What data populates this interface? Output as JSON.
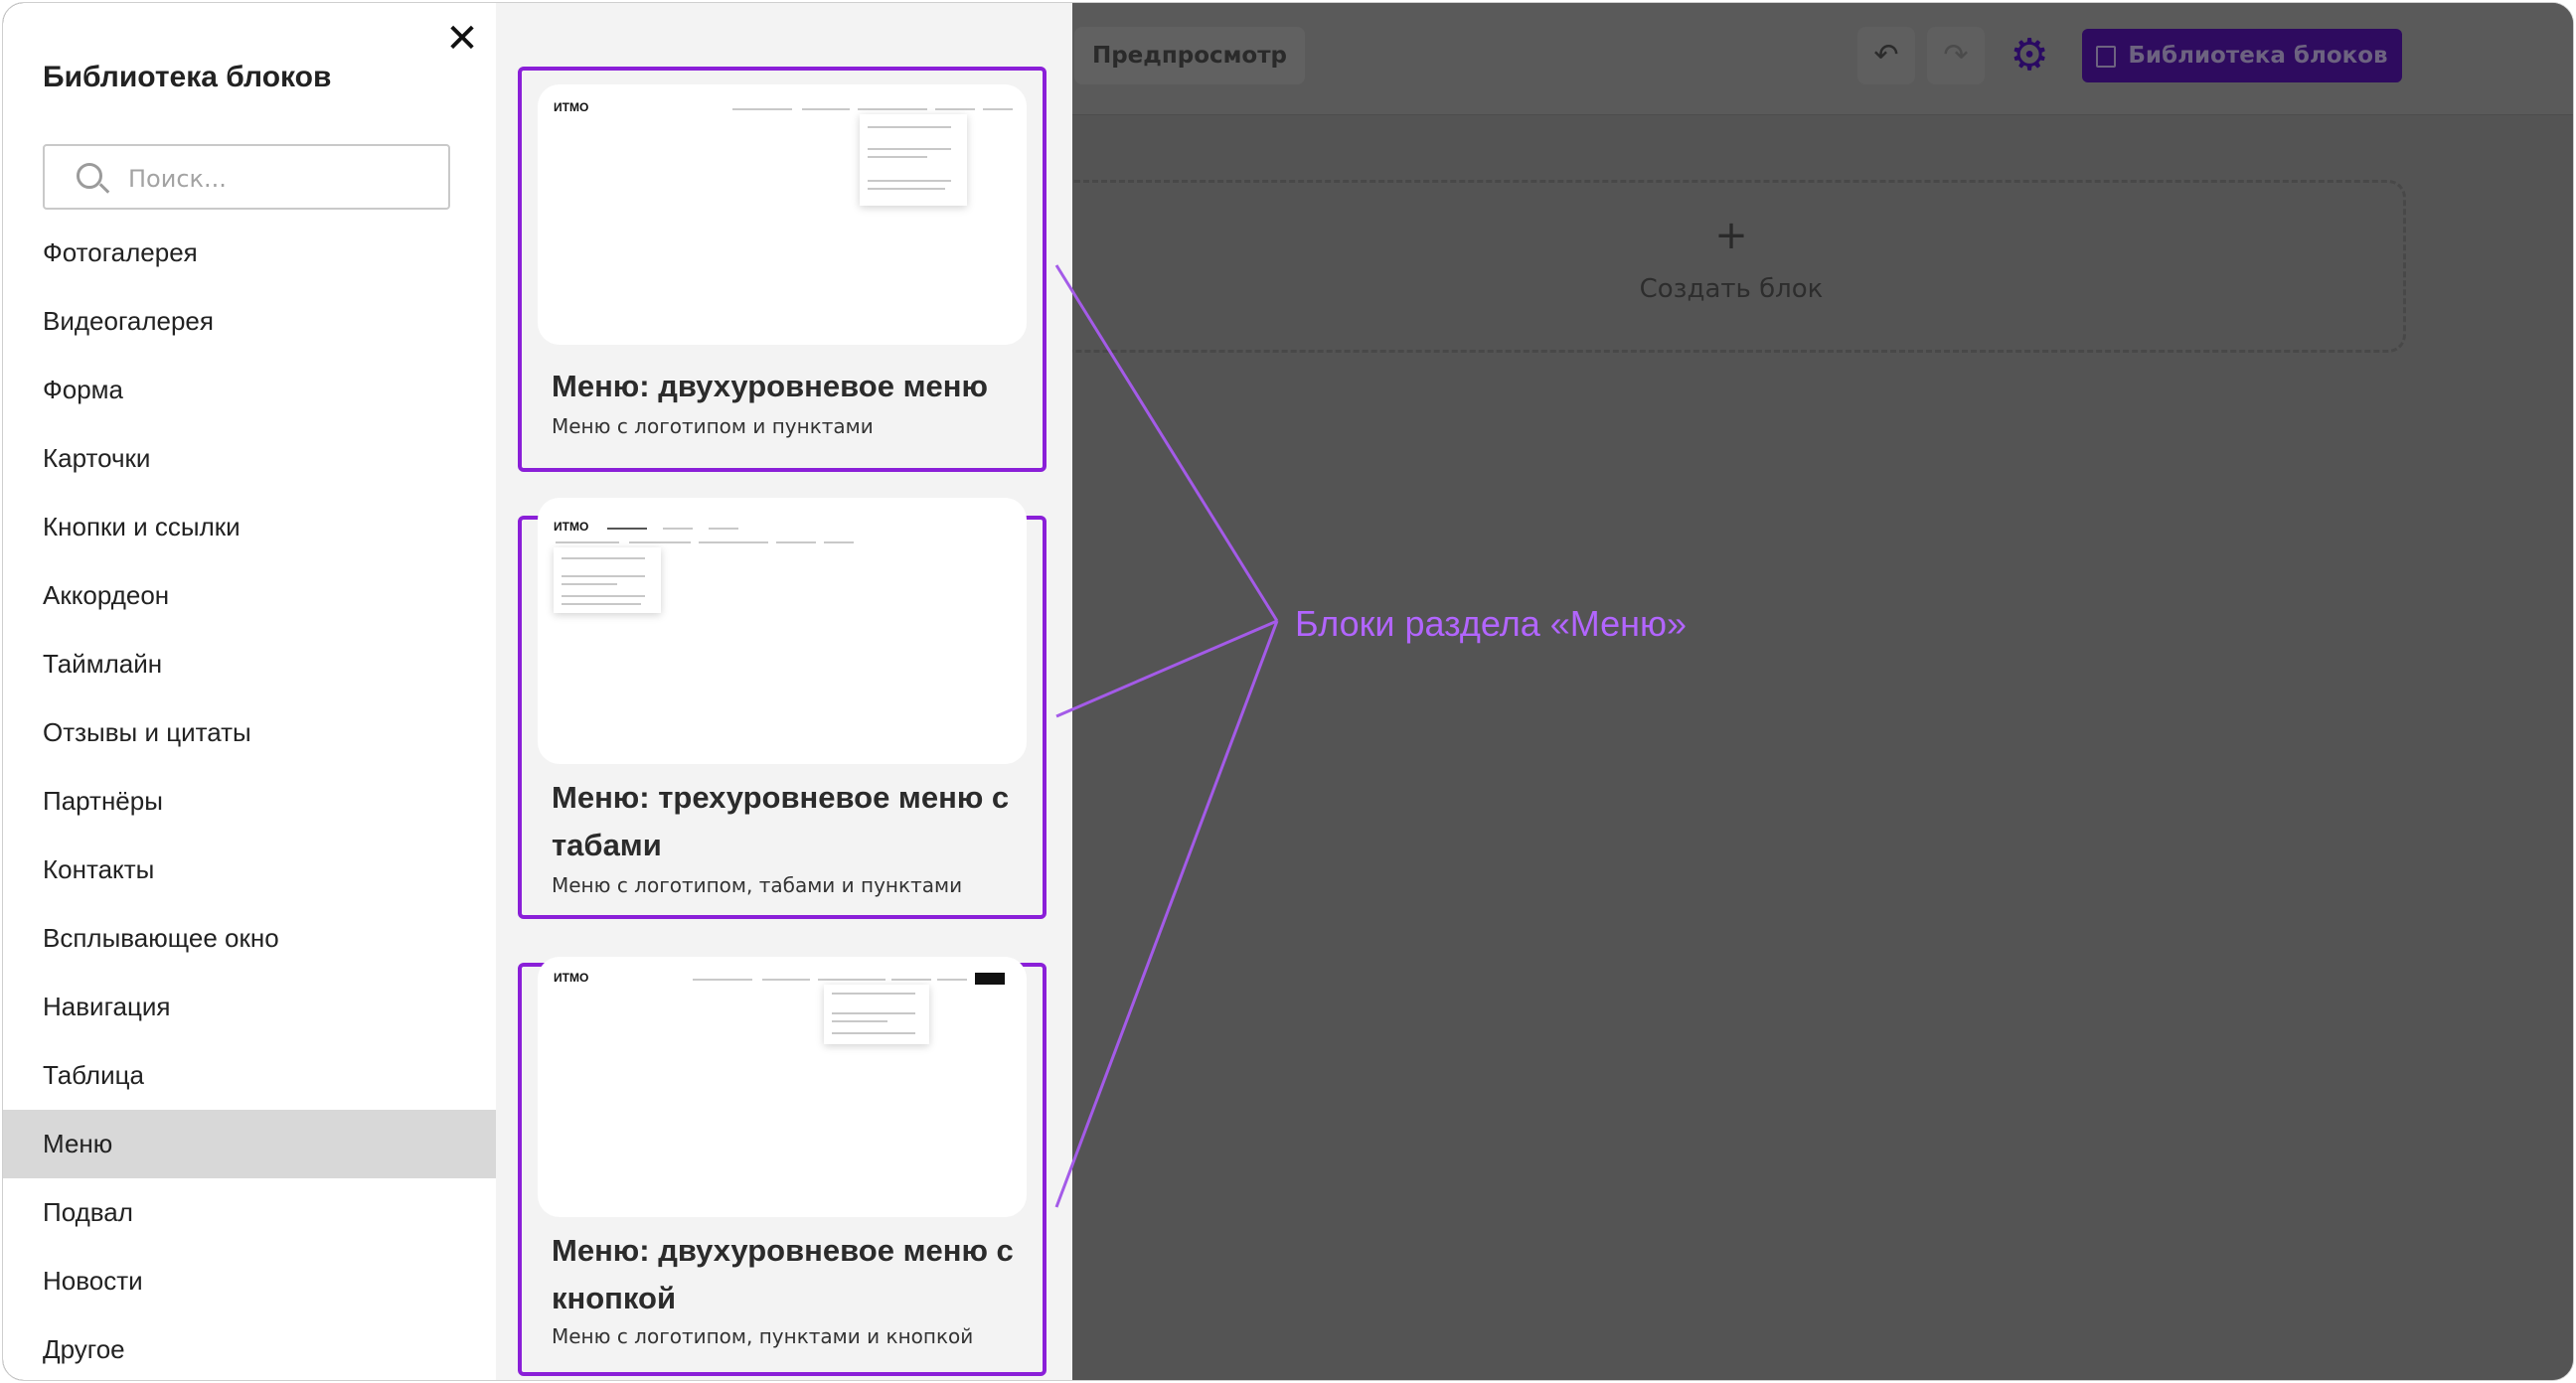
{
  "editor": {
    "preview_label": "Предпросмотр",
    "undo_icon": "undo-icon",
    "redo_icon": "redo-icon",
    "settings_icon": "gear-icon",
    "library_button_label": "Библиотека блоков",
    "create_block_label": "Создать блок"
  },
  "sidebar": {
    "title": "Библиотека блоков",
    "search_placeholder": "Поиск...",
    "categories": [
      "Фотогалерея",
      "Видеогалерея",
      "Форма",
      "Карточки",
      "Кнопки и ссылки",
      "Аккордеон",
      "Таймлайн",
      "Отзывы и цитаты",
      "Партнёры",
      "Контакты",
      "Всплывающее окно",
      "Навигация",
      "Таблица",
      "Меню",
      "Подвал",
      "Новости",
      "Другое"
    ],
    "active_category": "Меню"
  },
  "cards": [
    {
      "title": "Меню: двухуровневое меню",
      "subtitle": "Меню с логотипом и пунктами",
      "preview_logo": "ИТМО"
    },
    {
      "title": "Меню: трехуровневое меню с табами",
      "subtitle": "Меню с логотипом, табами и пунктами",
      "preview_logo": "ИТМО"
    },
    {
      "title": "Меню: двухуровневое меню с кнопкой",
      "subtitle": "Меню с логотипом, пунктами и кнопкой",
      "preview_logo": "ИТМО"
    }
  ],
  "annotation": {
    "label": "Блоки раздела «Меню»",
    "color": "#b265ff"
  },
  "colors": {
    "accent": "#8a1fd8",
    "overlay": "#545454",
    "active_item": "#d8d8d8"
  }
}
